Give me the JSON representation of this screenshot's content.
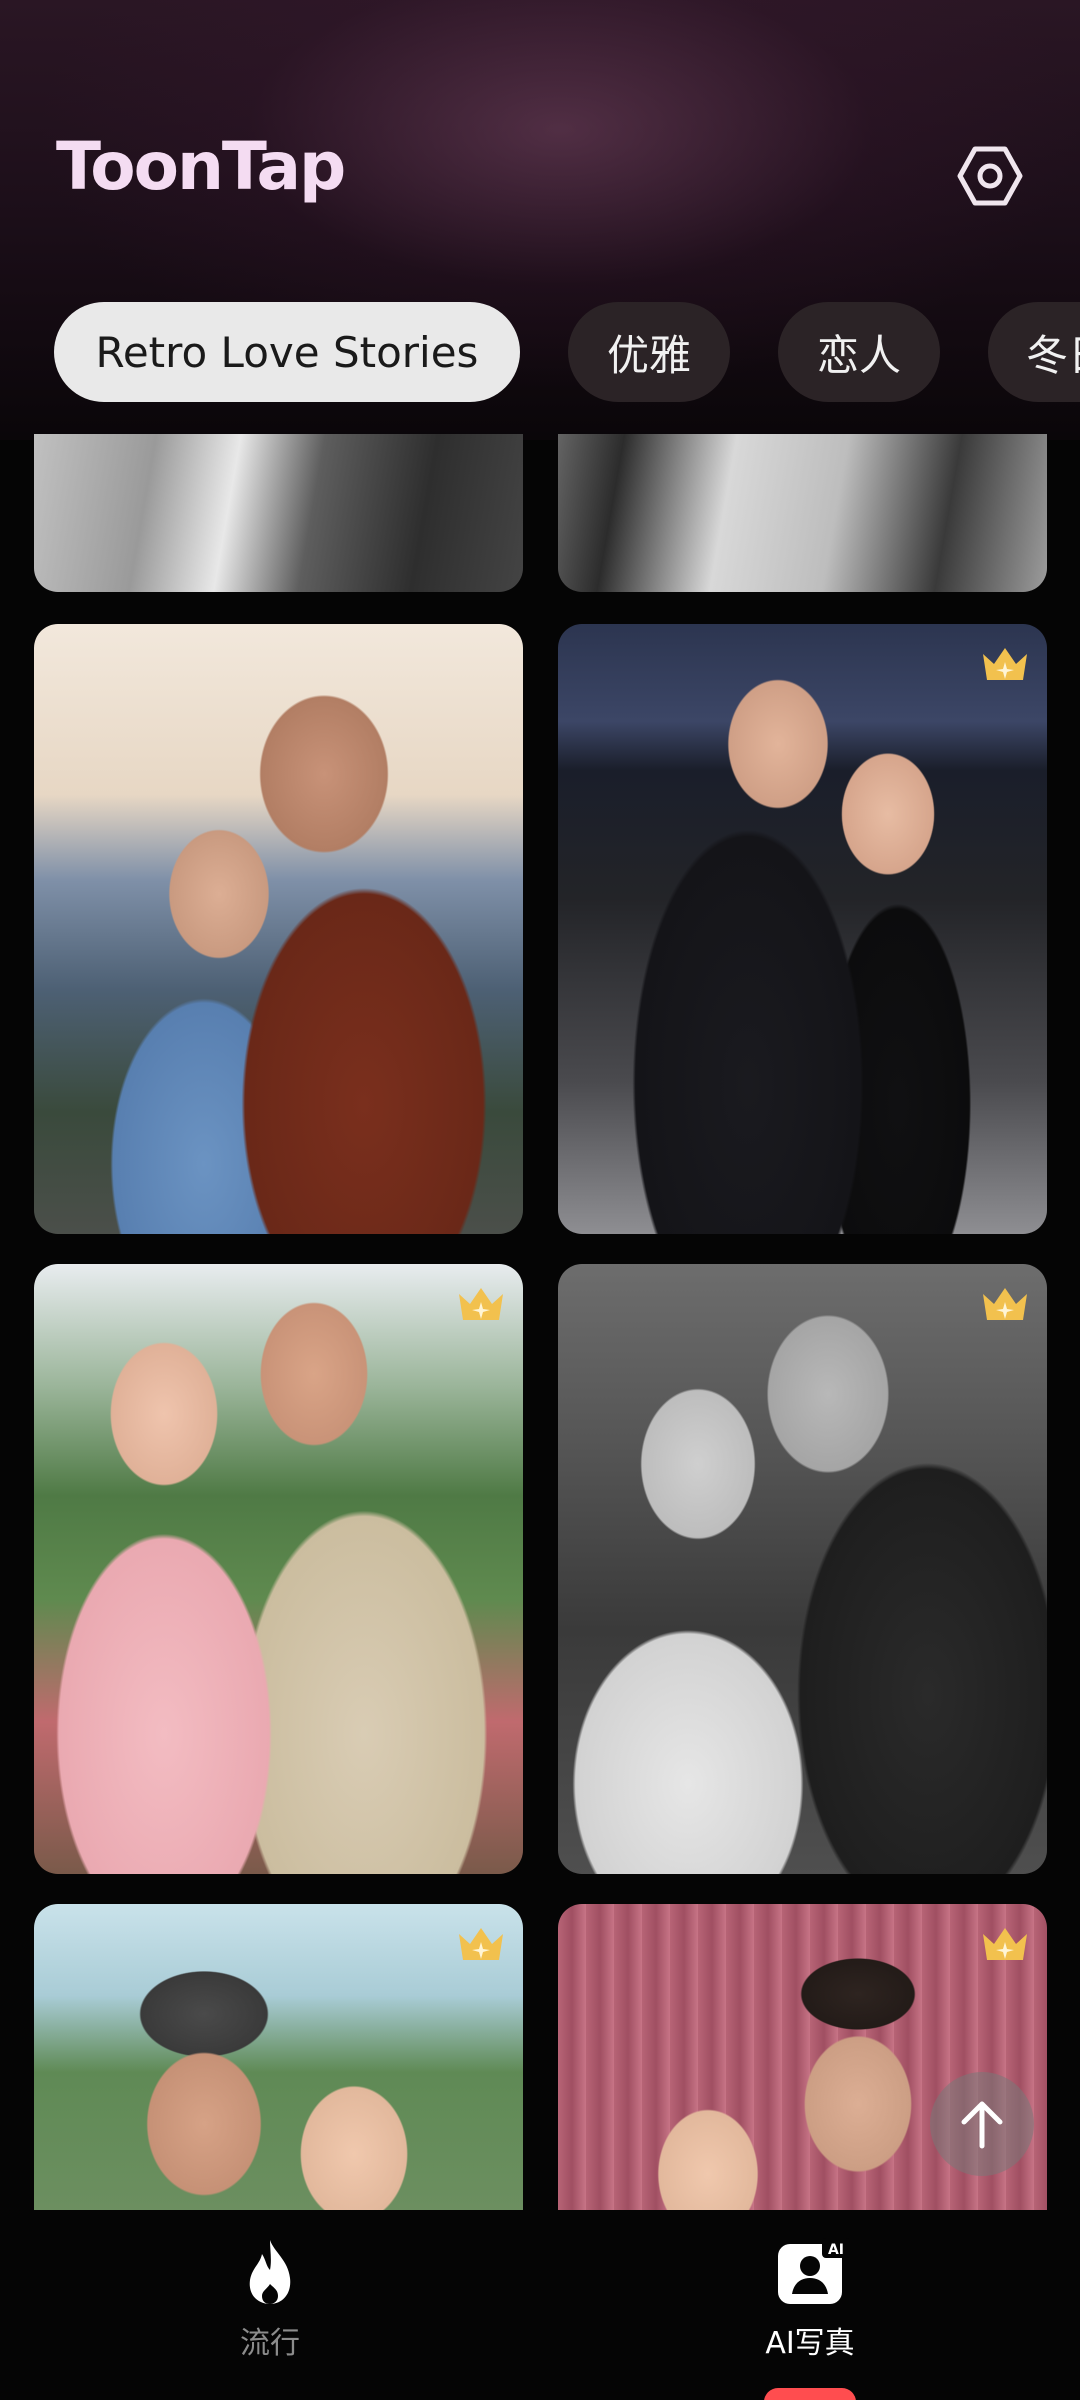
{
  "app": {
    "title": "ToonTap",
    "settings_icon": "settings-hexagon-icon"
  },
  "categories": [
    {
      "label": "Retro Love Stories",
      "active": true
    },
    {
      "label": "优雅",
      "active": false
    },
    {
      "label": "恋人",
      "active": false
    },
    {
      "label": "冬日",
      "active": false
    }
  ],
  "grid": {
    "cards": [
      {
        "description": "black-and-white couple photo (partially visible)",
        "premium": false
      },
      {
        "description": "black-and-white couple photo (partially visible)",
        "premium": false
      },
      {
        "description": "couple at mountain sunset",
        "premium": false
      },
      {
        "description": "couple in formal wear on rooftop at night",
        "premium": true
      },
      {
        "description": "couple in garden, pink gingham dress",
        "premium": true
      },
      {
        "description": "black-and-white vintage wedding portrait",
        "premium": true
      },
      {
        "description": "couple outdoors with trees",
        "premium": true
      },
      {
        "description": "couple in front of pink curtain",
        "premium": true
      }
    ],
    "premium_icon": "crown-icon"
  },
  "scroll_top_icon": "arrow-up-icon",
  "bottom_nav": {
    "items": [
      {
        "label": "流行",
        "icon": "flame-icon",
        "active": false
      },
      {
        "label": "AI写真",
        "icon": "ai-portrait-icon",
        "badge": "AI",
        "active": true
      }
    ]
  },
  "colors": {
    "accent": "#ff4d4f",
    "chip_active_bg": "#e9e9e9",
    "chip_inactive_bg": "#2b2326",
    "crown": "#f2c14e",
    "logo": "#f4dcf2"
  }
}
